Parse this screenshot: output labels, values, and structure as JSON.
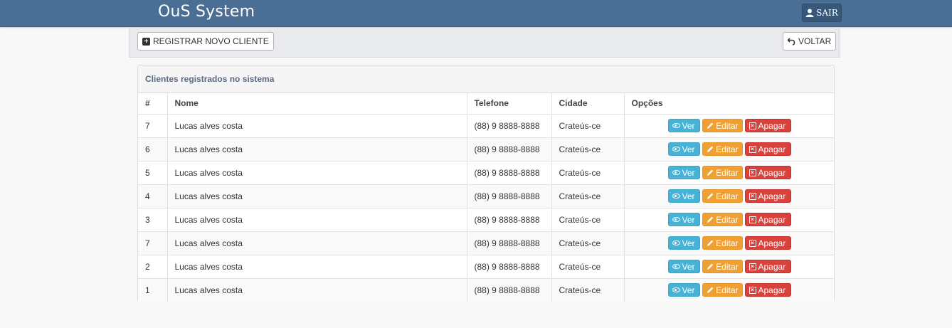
{
  "app": {
    "title": "OuS System",
    "logout_label": "SAIR"
  },
  "toolbar": {
    "new_client_label": "REGISTRAR NOVO CLIENTE",
    "back_label": "VOLTAR"
  },
  "panel": {
    "heading": "Clientes registrados no sistema"
  },
  "table": {
    "headers": [
      "#",
      "Nome",
      "Telefone",
      "Cidade",
      "Opções"
    ],
    "rows": [
      {
        "id": "7",
        "name": "Lucas alves costa",
        "phone": "(88) 9 8888-8888",
        "city": "Crateús-ce"
      },
      {
        "id": "6",
        "name": "Lucas alves costa",
        "phone": "(88) 9 8888-8888",
        "city": "Crateús-ce"
      },
      {
        "id": "5",
        "name": "Lucas alves costa",
        "phone": "(88) 9 8888-8888",
        "city": "Crateús-ce"
      },
      {
        "id": "4",
        "name": "Lucas alves costa",
        "phone": "(88) 9 8888-8888",
        "city": "Crateús-ce"
      },
      {
        "id": "3",
        "name": "Lucas alves costa",
        "phone": "(88) 9 8888-8888",
        "city": "Crateús-ce"
      },
      {
        "id": "7",
        "name": "Lucas alves costa",
        "phone": "(88) 9 8888-8888",
        "city": "Crateús-ce"
      },
      {
        "id": "2",
        "name": "Lucas alves costa",
        "phone": "(88) 9 8888-8888",
        "city": "Crateús-ce"
      },
      {
        "id": "1",
        "name": "Lucas alves costa",
        "phone": "(88) 9 8888-8888",
        "city": "Crateús-ce"
      }
    ],
    "actions": {
      "view": "Ver",
      "edit": "Editar",
      "delete": "Apagar"
    }
  },
  "colors": {
    "navbar": "#4b6e95",
    "info": "#46b3d6",
    "warning": "#f0a032",
    "danger": "#d9413c"
  },
  "icons": {
    "logout": "user-icon",
    "new": "plus-square-icon",
    "back": "undo-arrow-icon",
    "view": "eye-icon",
    "edit": "pencil-icon",
    "delete": "x-square-icon"
  }
}
